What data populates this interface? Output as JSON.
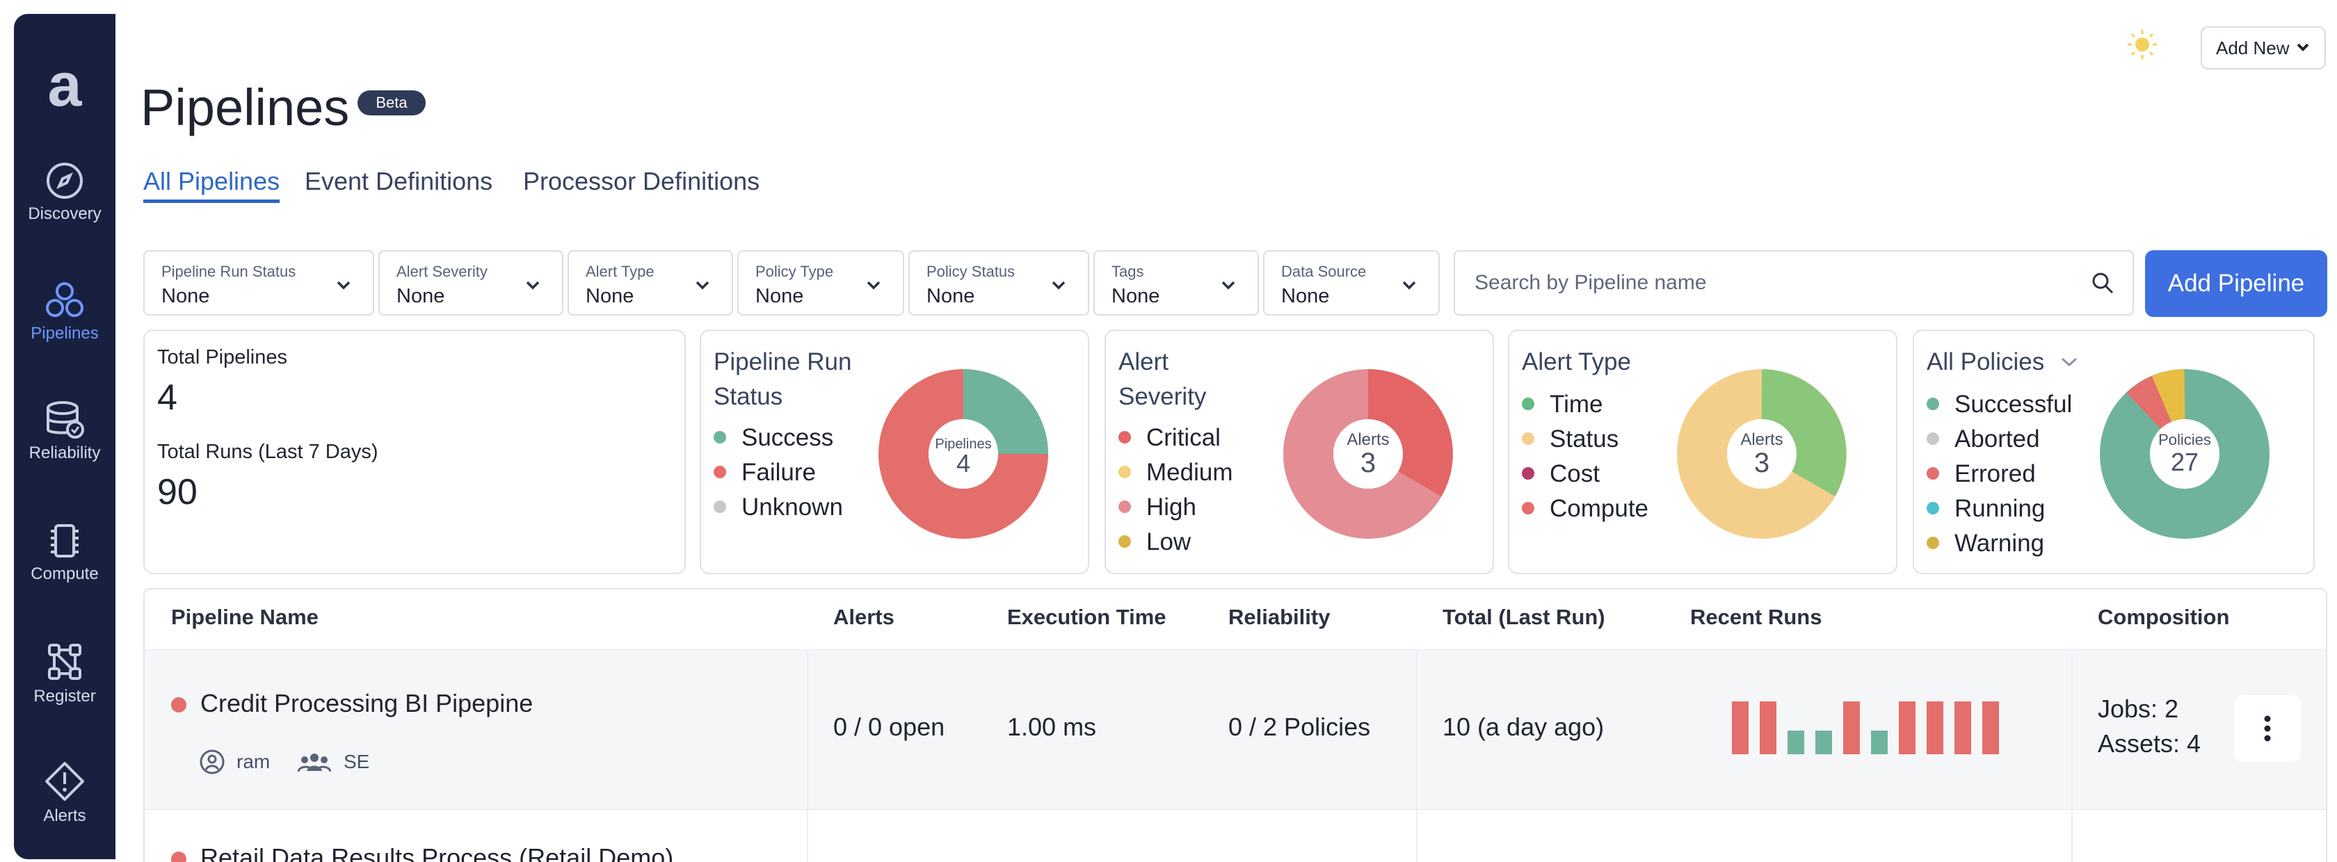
{
  "sidebar": {
    "logo": "a",
    "items": [
      {
        "label": "Discovery",
        "icon": "compass-icon"
      },
      {
        "label": "Pipelines",
        "icon": "pipelines-icon",
        "active": true
      },
      {
        "label": "Reliability",
        "icon": "database-check-icon"
      },
      {
        "label": "Compute",
        "icon": "chip-icon"
      },
      {
        "label": "Register",
        "icon": "network-icon"
      },
      {
        "label": "Alerts",
        "icon": "alert-diamond-icon"
      }
    ]
  },
  "header": {
    "title": "Pipelines",
    "badge": "Beta",
    "add_new": "Add New",
    "theme_icon": "lightbulb-icon"
  },
  "tabs": [
    {
      "label": "All Pipelines",
      "active": true
    },
    {
      "label": "Event Definitions"
    },
    {
      "label": "Processor Definitions"
    }
  ],
  "filters": [
    {
      "label": "Pipeline Run Status",
      "value": "None"
    },
    {
      "label": "Alert Severity",
      "value": "None"
    },
    {
      "label": "Alert Type",
      "value": "None"
    },
    {
      "label": "Policy Type",
      "value": "None"
    },
    {
      "label": "Policy Status",
      "value": "None"
    },
    {
      "label": "Tags",
      "value": "None"
    },
    {
      "label": "Data Source",
      "value": "None"
    }
  ],
  "search": {
    "placeholder": "Search by Pipeline name"
  },
  "add_pipeline": "Add Pipeline",
  "summary": {
    "total_pipelines_label": "Total Pipelines",
    "total_pipelines": "4",
    "total_runs_label": "Total Runs (Last 7 Days)",
    "total_runs": "90"
  },
  "cards": {
    "run_status": {
      "title_line1": "Pipeline Run",
      "title_line2": "Status",
      "center_label": "Pipelines",
      "center_value": "4",
      "legend": [
        {
          "label": "Success",
          "color": "#6fb39d"
        },
        {
          "label": "Failure",
          "color": "#e66c67"
        },
        {
          "label": "Unknown",
          "color": "#c8c8c8"
        }
      ]
    },
    "alert_severity": {
      "title_line1": "Alert",
      "title_line2": "Severity",
      "center_label": "Alerts",
      "center_value": "3",
      "legend": [
        {
          "label": "Critical",
          "color": "#e36565"
        },
        {
          "label": "Medium",
          "color": "#f1d27f"
        },
        {
          "label": "High",
          "color": "#e48d95"
        },
        {
          "label": "Low",
          "color": "#d7b444"
        }
      ]
    },
    "alert_type": {
      "title": "Alert Type",
      "center_label": "Alerts",
      "center_value": "3",
      "legend": [
        {
          "label": "Time",
          "color": "#62ba84"
        },
        {
          "label": "Status",
          "color": "#f4cf8c"
        },
        {
          "label": "Cost",
          "color": "#b23b68"
        },
        {
          "label": "Compute",
          "color": "#e46e6c"
        }
      ]
    },
    "policies": {
      "title": "All Policies",
      "center_label": "Policies",
      "center_value": "27",
      "legend": [
        {
          "label": "Successful",
          "color": "#6fb39d"
        },
        {
          "label": "Aborted",
          "color": "#c8c8c8"
        },
        {
          "label": "Errored",
          "color": "#e46e6c"
        },
        {
          "label": "Running",
          "color": "#4dbfd2"
        },
        {
          "label": "Warning",
          "color": "#d4b24a"
        }
      ]
    }
  },
  "table": {
    "columns": [
      "Pipeline Name",
      "Alerts",
      "Execution Time",
      "Reliability",
      "Total (Last Run)",
      "Recent Runs",
      "Composition"
    ],
    "rows": [
      {
        "name": "Credit Processing BI Pipepine",
        "owner": "ram",
        "team": "SE",
        "alerts": "0 / 0 open",
        "execution_time": "1.00 ms",
        "reliability": "0 / 2 Policies",
        "total_last_run": "10 (a day ago)",
        "composition_jobs": "Jobs: 2",
        "composition_assets": "Assets: 4",
        "recent_runs": [
          "fail",
          "fail",
          "success",
          "success",
          "fail",
          "success",
          "fail",
          "fail",
          "fail",
          "fail"
        ]
      }
    ],
    "partial_row_name": "Retail Data Results Process (Retail Demo)"
  }
}
